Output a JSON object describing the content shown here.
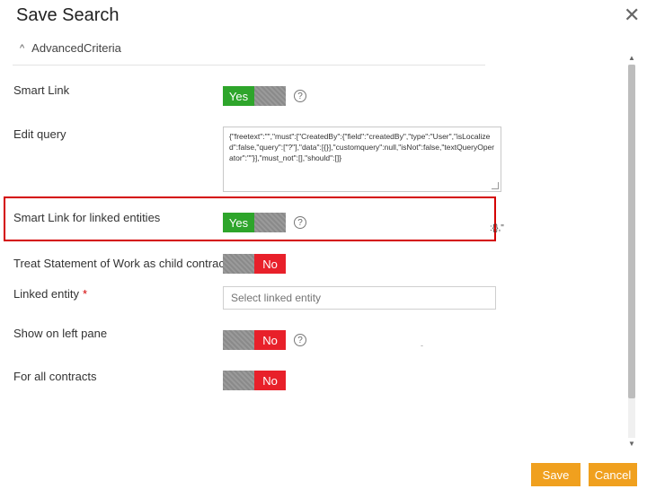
{
  "dialog": {
    "title": "Save Search",
    "close_symbol": "✕",
    "close_icon": "close-icon"
  },
  "section": {
    "label": "AdvancedCriteria",
    "chevron_symbol": "^",
    "chevron_icon": "chevron-up-icon"
  },
  "fields": {
    "smart_link": {
      "label": "Smart Link",
      "on_text": "Yes",
      "value": "on"
    },
    "edit_query": {
      "label": "Edit query",
      "value": "{\"freetext\":\"\",\"must\":[\"CreatedBy\":{\"field\":\"createdBy\",\"type\":\"User\",\"isLocalized\":false,\"query\":[\"?\"],\"data\":[{}],\"customquery\":null,\"isNot\":false,\"textQueryOperator\":\"\"}],\"must_not\":[],\"should\":[]}"
    },
    "smart_link_linked": {
      "label": "Smart Link for linked entities",
      "on_text": "Yes",
      "value": "on"
    },
    "treat_sow": {
      "label": "Treat Statement of Work as child contract",
      "off_text": "No",
      "value": "off"
    },
    "linked_entity": {
      "label": "Linked entity",
      "required_mark": "*",
      "placeholder": "Select linked entity"
    },
    "show_left_pane": {
      "label": "Show on left pane",
      "off_text": "No",
      "value": "off"
    },
    "all_contracts": {
      "label": "For all contracts",
      "off_text": "No",
      "value": "off"
    }
  },
  "help_symbol": "?",
  "stray_text": ":{},\"",
  "stray_dash": "-",
  "scrollbar": {
    "up": "▲",
    "down": "▼"
  },
  "buttons": {
    "save": "Save",
    "cancel": "Cancel"
  },
  "colors": {
    "yes": "#2ea52b",
    "no": "#e8202a",
    "accent": "#f0a01e",
    "highlight": "#d40000"
  }
}
